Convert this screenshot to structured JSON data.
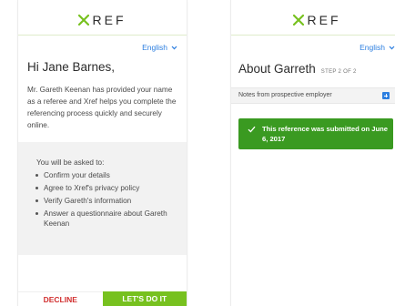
{
  "brand": {
    "logo_text": "REF",
    "accent": "#77c11f",
    "link": "#2d7fe0"
  },
  "left": {
    "language": "English",
    "greeting": "Hi Jane Barnes,",
    "intro": "Mr. Gareth Keenan has provided your name as a referee and Xref helps you complete the referencing process quickly and securely online.",
    "tasks_title": "You will be asked to:",
    "tasks": [
      "Confirm your details",
      "Agree to Xref's privacy policy",
      "Verify Gareth's information",
      "Answer a questionnaire about Gareth Keenan"
    ],
    "decline_label": "DECLINE",
    "accept_label": "LET'S DO IT",
    "decline_color": "#d12f2f"
  },
  "right": {
    "language": "English",
    "title": "About Garreth",
    "step": "STEP 2 OF 2",
    "notes_label": "Notes from prospective employer",
    "alert_text": "This reference was submitted on June 6, 2017",
    "alert_color": "#3a9a21"
  },
  "icons": {
    "logo": "x-logo-icon",
    "language": "chevron-down-icon",
    "add": "plus-icon",
    "alert": "check-icon"
  }
}
